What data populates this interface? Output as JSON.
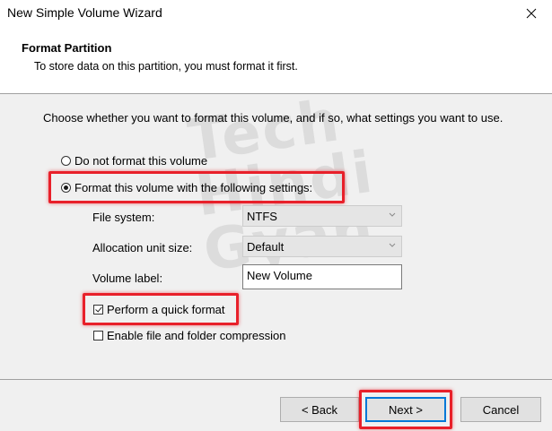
{
  "window": {
    "title": "New Simple Volume Wizard"
  },
  "header": {
    "title": "Format Partition",
    "subtitle": "To store data on this partition, you must format it first."
  },
  "body": {
    "intro": "Choose whether you want to format this volume, and if so, what settings you want to use.",
    "option_no_format": "Do not format this volume",
    "option_format": "Format this volume with the following settings:",
    "selected_option": "format",
    "file_system_label": "File system:",
    "file_system_value": "NTFS",
    "allocation_label": "Allocation unit size:",
    "allocation_value": "Default",
    "volume_label_label": "Volume label:",
    "volume_label_value": "New Volume",
    "quick_format_label": "Perform a quick format",
    "quick_format_checked": true,
    "compression_label": "Enable file and folder compression",
    "compression_checked": false
  },
  "watermark": {
    "line1": "Tech",
    "line2": "Hindi",
    "line3": "Gyan"
  },
  "footer": {
    "back_label": "< Back",
    "next_label": "Next >",
    "cancel_label": "Cancel"
  },
  "colors": {
    "highlight": "#e8202a",
    "accent": "#0078d7"
  }
}
